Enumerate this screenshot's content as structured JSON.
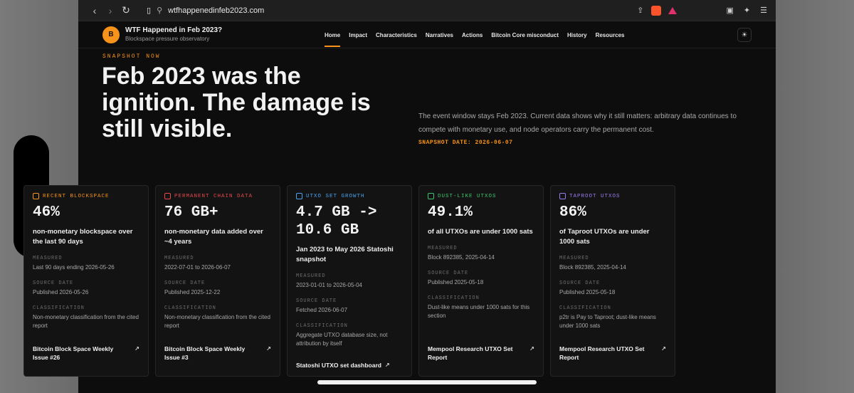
{
  "browser": {
    "url": "wtfhappenedinfeb2023.com"
  },
  "site": {
    "logo_letter": "B",
    "title": "WTF Happened in Feb 2023?",
    "subtitle": "Blockspace pressure observatory",
    "nav": [
      "Home",
      "Impact",
      "Characteristics",
      "Narratives",
      "Actions",
      "Bitcoin Core misconduct",
      "History",
      "Resources"
    ]
  },
  "hero": {
    "kicker": "SNAPSHOT NOW",
    "headline": "Feb 2023 was the ignition. The damage is still visible.",
    "lead": "The event window stays Feb 2023. Current data shows why it still matters: arbitrary data continues to compete with monetary use, and node operators carry the permanent cost.",
    "snapshot_date": "SNAPSHOT DATE: 2026-06-07"
  },
  "labels": {
    "measured": "MEASURED",
    "source_date": "SOURCE DATE",
    "classification": "CLASSIFICATION"
  },
  "cards": [
    {
      "tag": "RECENT BLOCKSPACE",
      "color": "#f7931a",
      "value": "46%",
      "desc": "non-monetary blockspace over the last 90 days",
      "measured": "Last 90 days ending 2026-05-26",
      "source_date": "Published 2026-05-26",
      "classification": "Non-monetary classification from the cited report",
      "link": "Bitcoin Block Space Weekly Issue #26"
    },
    {
      "tag": "PERMANENT CHAIN DATA",
      "color": "#e5484d",
      "value": "76 GB+",
      "desc": "non-monetary data added over ~4 years",
      "measured": "2022-07-01 to 2026-06-07",
      "source_date": "Published 2025-12-22",
      "classification": "Non-monetary classification from the cited report",
      "link": "Bitcoin Block Space Weekly Issue #3"
    },
    {
      "tag": "UTXO SET GROWTH",
      "color": "#4aa3f0",
      "value": "4.7 GB -> 10.6 GB",
      "desc": "Jan 2023 to May 2026 Statoshi snapshot",
      "measured": "2023-01-01 to 2026-05-04",
      "source_date": "Fetched 2026-06-07",
      "classification": "Aggregate UTXO database size, not attribution by itself",
      "link": "Statoshi UTXO set dashboard"
    },
    {
      "tag": "DUST-LIKE UTXOS",
      "color": "#3ec46d",
      "value": "49.1%",
      "desc": "of all UTXOs are under 1000 sats",
      "measured": "Block 892385, 2025-04-14",
      "source_date": "Published 2025-05-18",
      "classification": "Dust-like means under 1000 sats for this section",
      "link": "Mempool Research UTXO Set Report"
    },
    {
      "tag": "TAPROOT UTXOS",
      "color": "#9b7cf0",
      "value": "86%",
      "desc": "of Taproot UTXOs are under 1000 sats",
      "measured": "Block 892385, 2025-04-14",
      "source_date": "Published 2025-05-18",
      "classification": "p2tr is Pay to Taproot; dust-like means under 1000 sats",
      "link": "Mempool Research UTXO Set Report"
    }
  ]
}
